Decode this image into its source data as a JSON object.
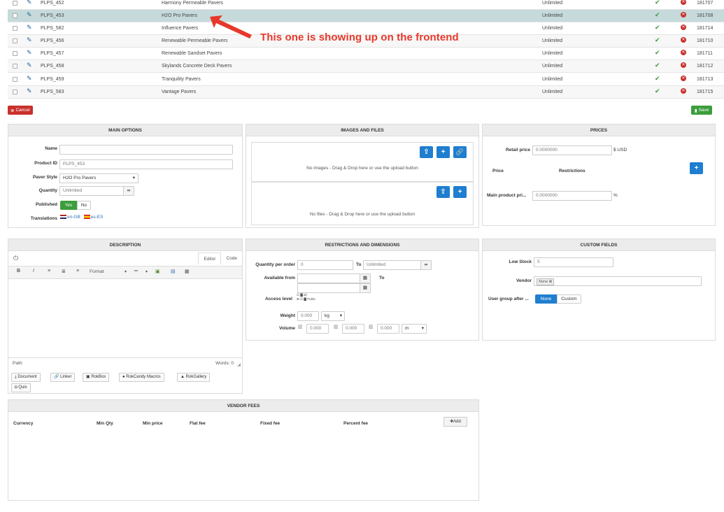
{
  "products": [
    {
      "id": "PLPS_452",
      "name": "Harmony Permeable Pavers",
      "quantity": "Unlimited",
      "number": "181707"
    },
    {
      "id": "PLPS_453",
      "name": "H2O Pro Pavers",
      "quantity": "Unlimited",
      "number": "181708"
    },
    {
      "id": "PLPS_582",
      "name": "Influence Pavers",
      "quantity": "Unlimited",
      "number": "181714"
    },
    {
      "id": "PLPS_456",
      "name": "Renewable Permeable Pavers",
      "quantity": "Unlimited",
      "number": "181710"
    },
    {
      "id": "PLPS_457",
      "name": "Renewable Sandset Pavers",
      "quantity": "Unlimited",
      "number": "181711"
    },
    {
      "id": "PLPS_458",
      "name": "Skylands Concrete Deck Pavers",
      "quantity": "Unlimited",
      "number": "181712"
    },
    {
      "id": "PLPS_459",
      "name": "Tranquility Pavers",
      "quantity": "Unlimited",
      "number": "181713"
    },
    {
      "id": "PLPS_583",
      "name": "Vantage Pavers",
      "quantity": "Unlimited",
      "number": "181715"
    }
  ],
  "annotation": "This one is showing up on the frontend",
  "actions": {
    "cancel": "Cancel",
    "save": "Save"
  },
  "main_options": {
    "title": "MAIN OPTIONS",
    "name_label": "Name",
    "name_value": "",
    "product_id_label": "Product ID",
    "product_id_value": "PLPS_453",
    "paver_style_label": "Paver Style",
    "paver_style_value": "H2O Pro Pavers",
    "quantity_label": "Quantity",
    "quantity_value": "Unlimited",
    "published_label": "Published",
    "yes": "Yes",
    "no": "No",
    "translations_label": "Translations",
    "lang1": "en-GB",
    "lang2": "es-ES"
  },
  "images_files": {
    "title": "IMAGES AND FILES",
    "images_text": "No images - Drag & Drop here or use the upload button",
    "files_text": "No files - Drag & Drop here or use the upload button"
  },
  "prices": {
    "title": "PRICES",
    "retail_label": "Retail price",
    "retail_value": "0.0000000",
    "currency": "$ USD",
    "price_col": "Price",
    "restrictions_col": "Restrictions",
    "main_label": "Main product pri...",
    "main_value": "0.0000000",
    "percent": "%"
  },
  "description": {
    "title": "DESCRIPTION",
    "tab_editor": "Editor",
    "tab_code": "Code",
    "format_label": "Format",
    "path_label": "Path:",
    "words_label": "Words: 0",
    "plugins": [
      "Document",
      "Linker",
      "RokBox",
      "RokCandy Macros",
      "RokGallery",
      "Quix"
    ]
  },
  "restrictions": {
    "title": "RESTRICTIONS AND DIMENSIONS",
    "qty_label": "Quantity per order",
    "qty_from": "0",
    "to_label": "To",
    "qty_to": "Unlimited",
    "available_label": "Available from",
    "access_label": "Access level",
    "access_all": "all",
    "access_public": "Public",
    "weight_label": "Weight",
    "weight_value": "0.000",
    "weight_unit": "kg",
    "volume_label": "Volume",
    "vol1": "0.000",
    "vol2": "0.000",
    "vol3": "0.000",
    "volume_unit": "m"
  },
  "custom_fields": {
    "title": "CUSTOM FIELDS",
    "low_stock_label": "Low Stock",
    "low_stock_value": "5",
    "vendor_label": "Vendor",
    "vendor_value": "None",
    "user_group_label": "User group after ...",
    "opt_none": "None",
    "opt_custom": "Custom"
  },
  "vendor_fees": {
    "title": "VENDOR FEES",
    "columns": [
      "Currency",
      "Min Qty",
      "Min price",
      "Flat fee",
      "Fixed fee",
      "Percent fee"
    ],
    "add_label": "Add"
  },
  "colors": {
    "accent": "#1f7ed0",
    "success": "#3c9d3c",
    "danger": "#c9302c",
    "annotation": "#e8382a",
    "selected_row": "#c6dadb"
  }
}
